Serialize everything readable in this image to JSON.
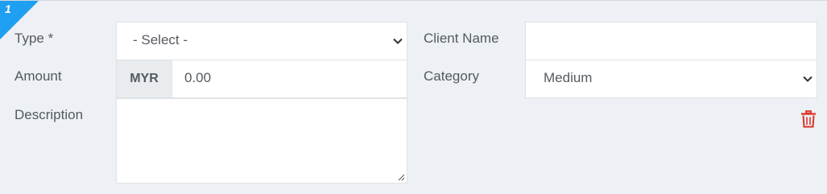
{
  "row": {
    "number": "1"
  },
  "fields": {
    "type_label": "Type *",
    "type_value": "- Select -",
    "amount_label": "Amount",
    "currency": "MYR",
    "amount_value": "0.00",
    "description_label": "Description",
    "description_value": "",
    "client_name_label": "Client Name",
    "client_name_value": "",
    "category_label": "Category",
    "category_value": "Medium"
  },
  "icons": {
    "chevron": "chevron-down-icon",
    "delete": "trash-icon",
    "resize": "resize-grip-icon"
  },
  "colors": {
    "corner_badge": "#1e9ff2",
    "delete_icon": "#d9322a",
    "background": "#edf0f4"
  }
}
